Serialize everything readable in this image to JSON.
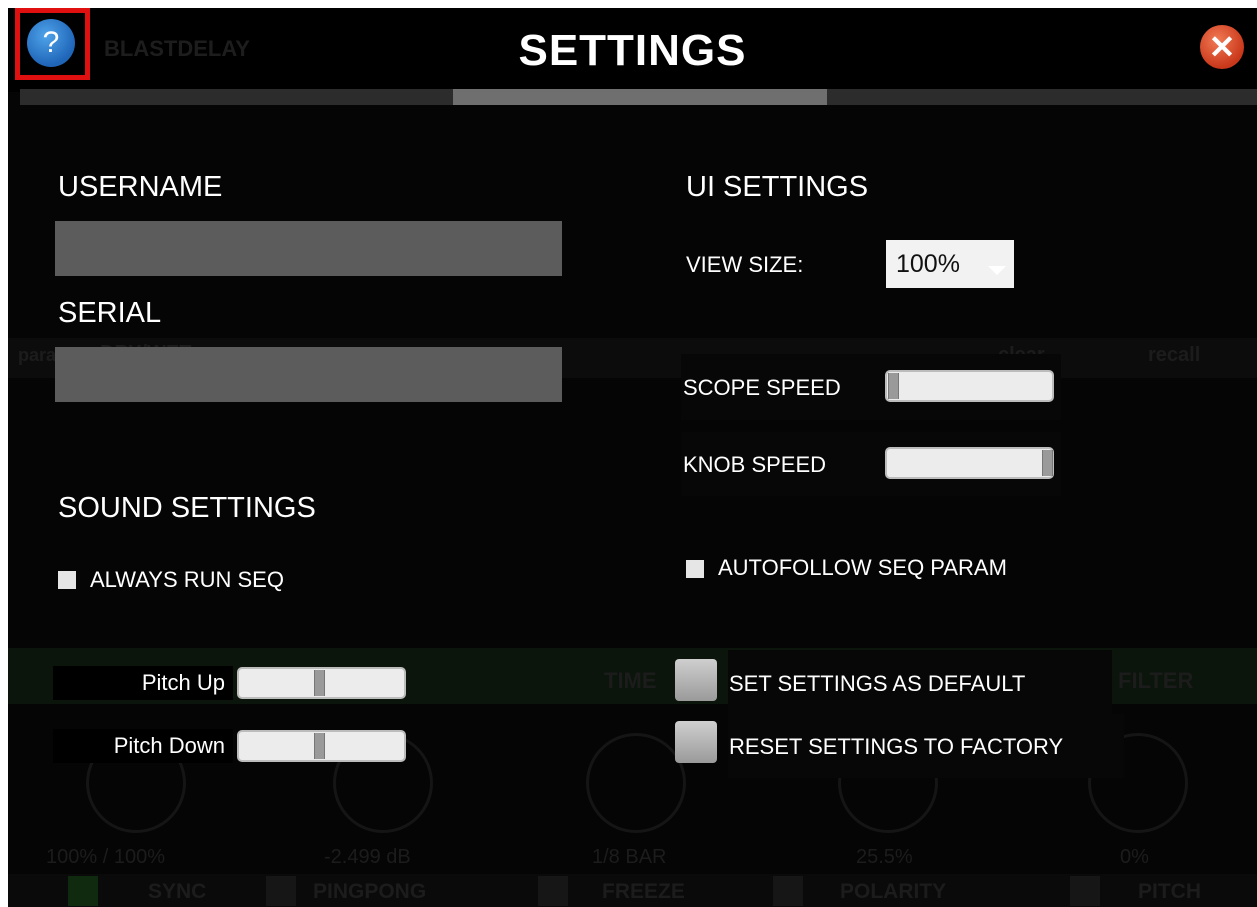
{
  "header": {
    "help_icon": "help-icon",
    "brand": "BLASTDELAY",
    "title": "SETTINGS",
    "close_icon": "close-icon"
  },
  "account": {
    "username_label": "USERNAME",
    "username_value": "",
    "serial_label": "SERIAL",
    "serial_value": ""
  },
  "ui_settings": {
    "heading": "UI SETTINGS",
    "view_size_label": "VIEW SIZE:",
    "view_size_value": "100%",
    "scope_speed_label": "SCOPE SPEED",
    "scope_speed_level": 0.02,
    "knob_speed_label": "KNOB SPEED",
    "knob_speed_level": 0.98,
    "autofollow_label": "AUTOFOLLOW SEQ PARAM",
    "autofollow_checked": false
  },
  "sound_settings": {
    "heading": "SOUND SETTINGS",
    "always_run_seq_label": "ALWAYS RUN SEQ",
    "always_run_seq_checked": false,
    "pitch_up_label": "Pitch Up",
    "pitch_up_level": 0.5,
    "pitch_down_label": "Pitch Down",
    "pitch_down_level": 0.5
  },
  "actions": {
    "set_default_label": "SET SETTINGS AS DEFAULT",
    "reset_factory_label": "RESET SETTINGS TO FACTORY"
  },
  "background": {
    "param_label": "para",
    "param_value": "DRY/WET",
    "clear_label": "clear",
    "recall_label": "recall",
    "section_labels": [
      "TIME",
      "FILTER"
    ],
    "knob_values": [
      "100% / 100%",
      "-2.499 dB",
      "1/8 BAR",
      "25.5%",
      "0%"
    ],
    "toggles": [
      "SYNC",
      "PINGPONG",
      "FREEZE",
      "POLARITY",
      "PITCH"
    ]
  }
}
